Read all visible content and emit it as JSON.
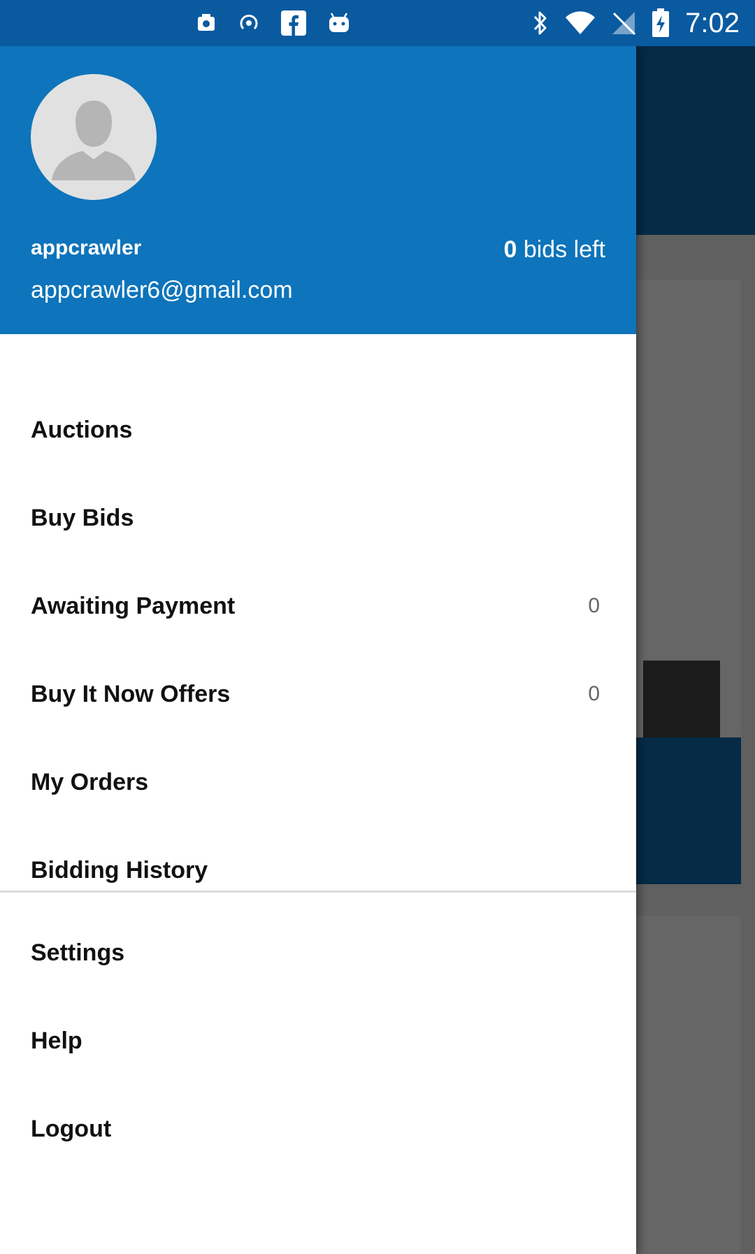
{
  "status_bar": {
    "time": "7:02",
    "left_icons": [
      "screenshot-icon",
      "hotspot-icon",
      "facebook-icon",
      "android-icon"
    ],
    "right_icons": [
      "bluetooth-icon",
      "wifi-icon",
      "no-sim-icon",
      "battery-charging-icon"
    ]
  },
  "drawer": {
    "header": {
      "username": "appcrawler",
      "email": "appcrawler6@gmail.com",
      "bids_count": "0",
      "bids_suffix": " bids left",
      "avatar_icon": "avatar-placeholder-icon"
    },
    "main_items": [
      {
        "label": "Auctions",
        "count": ""
      },
      {
        "label": "Buy Bids",
        "count": ""
      },
      {
        "label": "Awaiting Payment",
        "count": "0"
      },
      {
        "label": "Buy It Now Offers",
        "count": "0"
      },
      {
        "label": "My Orders",
        "count": ""
      },
      {
        "label": "Bidding History",
        "count": ""
      }
    ],
    "secondary_items": [
      {
        "label": "Settings"
      },
      {
        "label": "Help"
      },
      {
        "label": "Logout"
      }
    ]
  },
  "colors": {
    "header_blue": "#0e74bb",
    "status_bar": "#0a5aa0",
    "drawer_bg": "#ffffff",
    "text_dark": "#111111"
  }
}
